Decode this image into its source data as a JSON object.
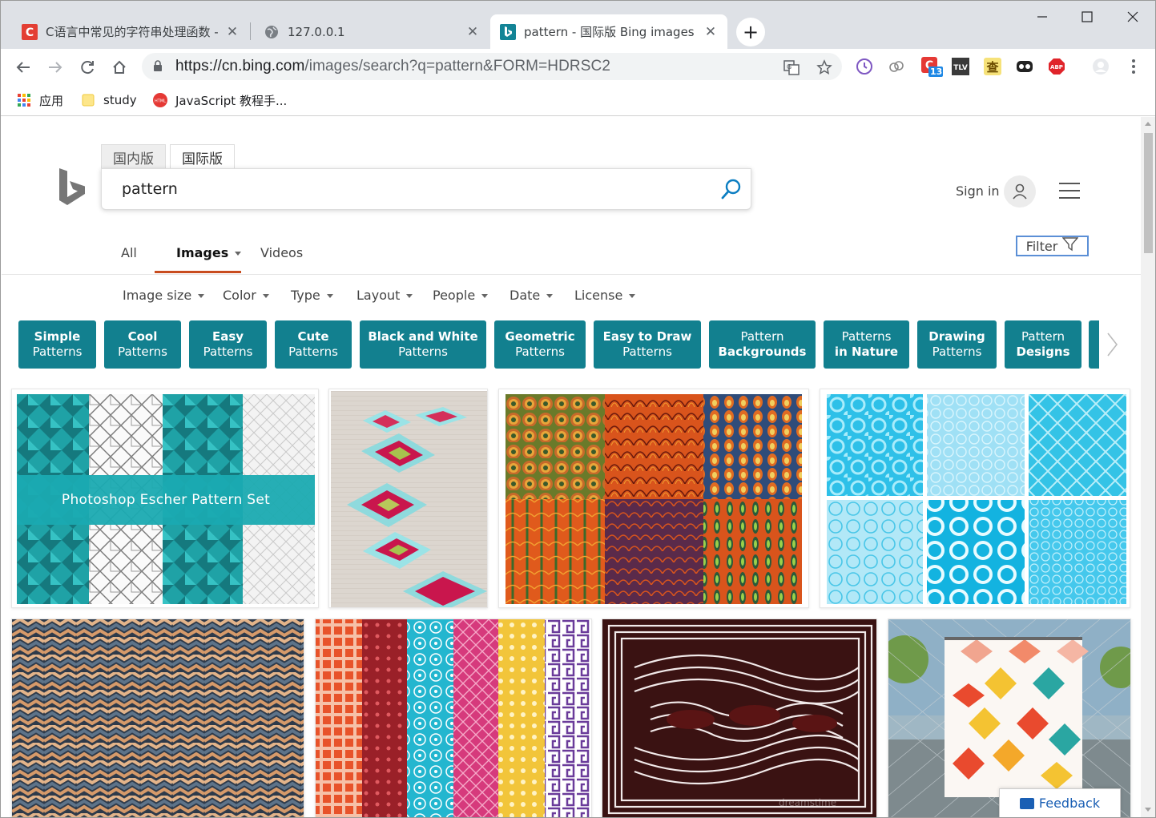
{
  "browser": {
    "tabs": [
      {
        "title": "C语言中常见的字符串处理函数 - ",
        "favicon": "csdn-icon"
      },
      {
        "title": "127.0.0.1",
        "favicon": "globe-icon"
      },
      {
        "title": "pattern - 国际版 Bing images",
        "favicon": "bing-icon"
      }
    ],
    "url_host": "https://cn.bing.com",
    "url_rest": "/images/search?q=pattern&FORM=HDRSC2",
    "extension_badge": "13",
    "bookmarks": [
      {
        "label": "应用",
        "icon": "apps-grid-icon"
      },
      {
        "label": "study",
        "icon": "folder-icon"
      },
      {
        "label": "JavaScript 教程手...",
        "icon": "html-icon"
      }
    ]
  },
  "bing": {
    "scope_tabs": [
      "国内版",
      "国际版"
    ],
    "query": "pattern",
    "sign_in": "Sign in",
    "vertical_tabs": [
      "All",
      "Images",
      "Videos"
    ],
    "filter_label": "Filter",
    "filters": [
      "Image size",
      "Color",
      "Type",
      "Layout",
      "People",
      "Date",
      "License"
    ],
    "pills": [
      {
        "l1": "Simple",
        "l2": "Patterns"
      },
      {
        "l1": "Cool",
        "l2": "Patterns"
      },
      {
        "l1": "Easy",
        "l2": "Patterns"
      },
      {
        "l1": "Cute",
        "l2": "Patterns"
      },
      {
        "l1": "Black and White",
        "l2": "Patterns"
      },
      {
        "l1": "Geometric",
        "l2": "Patterns"
      },
      {
        "l1": "Easy to Draw",
        "l2": "Patterns"
      },
      {
        "l1": "Pattern",
        "l2": "Backgrounds"
      },
      {
        "l1": "Patterns",
        "l2": "in Nature"
      },
      {
        "l1": "Drawing",
        "l2": "Patterns"
      },
      {
        "l1": "Pattern",
        "l2": "Designs"
      }
    ],
    "image1_caption": "Photoshop Escher Pattern Set",
    "image7_watermark": "dreamstime",
    "feedback": "Feedback"
  },
  "colors": {
    "pill": "#12808f",
    "accent_underline": "#c84c1e",
    "bing_logo": "#767676"
  }
}
